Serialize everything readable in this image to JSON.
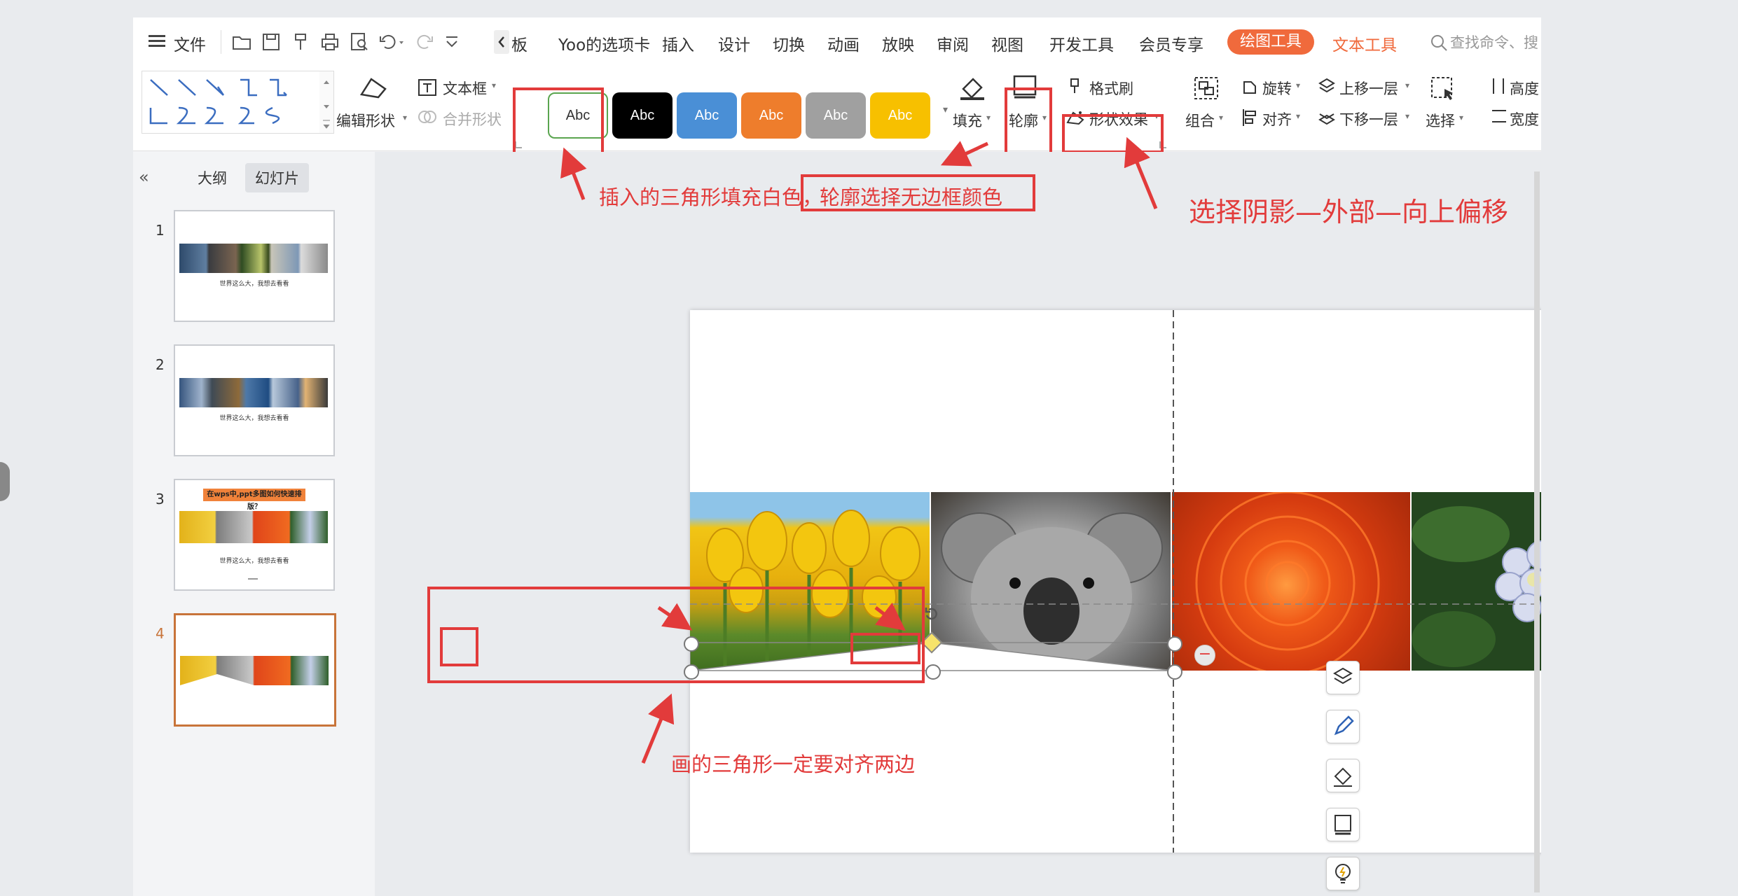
{
  "menubar": {
    "file": "文件",
    "tab_partial": "板",
    "tabs": [
      "Yoo的选项卡",
      "插入",
      "设计",
      "切换",
      "动画",
      "放映",
      "审阅",
      "视图",
      "开发工具",
      "会员专享"
    ],
    "active_tool_tab": "绘图工具",
    "text_tool_tab": "文本工具",
    "search_placeholder": "查找命令、搜"
  },
  "ribbon": {
    "edit_shape": "编辑形状",
    "text_box": "文本框",
    "merge_shape": "合并形状",
    "style_samples": [
      "Abc",
      "Abc",
      "Abc",
      "Abc",
      "Abc",
      "Abc"
    ],
    "fill": "填充",
    "outline": "轮廓",
    "format_painter": "格式刷",
    "shape_effects": "形状效果",
    "group": "组合",
    "rotate": "旋转",
    "align": "对齐",
    "bring_forward": "上移一层",
    "send_backward": "下移一层",
    "select": "选择",
    "height": "高度",
    "width": "宽度"
  },
  "leftpanel": {
    "outline_tab": "大纲",
    "slides_tab": "幻灯片",
    "slides": [
      {
        "num": "1",
        "caption": "世界这么大，我想去看看"
      },
      {
        "num": "2",
        "caption": "世界这么大，我想去看看"
      },
      {
        "num": "3",
        "title": "在wps中,ppt多图如何快速排版？",
        "caption": "世界这么大，我想去看看"
      },
      {
        "num": "4"
      }
    ]
  },
  "annotations": {
    "fill_note": "插入的三角形填充白色，",
    "outline_note": "轮廓选择无边框颜色",
    "shadow_note": "选择阴影—外部—向上偏移",
    "align_note": "画的三角形一定要对齐两边"
  },
  "colors": {
    "accent": "#f06a3c",
    "annotation_red": "#e23b3b",
    "text_tool": "#f06a3c",
    "style_black": "#000000",
    "style_blue": "#4a8fd6",
    "style_orange": "#ee7d2c",
    "style_gray": "#a0a0a0",
    "style_yellow": "#f7c000"
  }
}
